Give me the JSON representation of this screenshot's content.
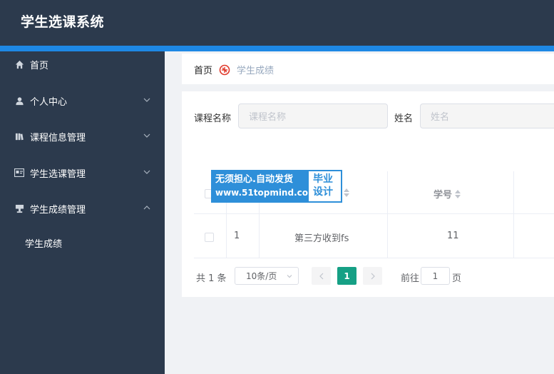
{
  "app": {
    "title": "学生选课系统"
  },
  "sidebar": {
    "items": [
      {
        "label": "首页",
        "icon": "home-icon"
      },
      {
        "label": "个人中心",
        "icon": "user-icon"
      },
      {
        "label": "课程信息管理",
        "icon": "book-icon"
      },
      {
        "label": "学生选课管理",
        "icon": "id-card-icon"
      },
      {
        "label": "学生成绩管理",
        "icon": "trophy-icon"
      }
    ],
    "sub_items": [
      {
        "label": "学生成绩"
      }
    ]
  },
  "breadcrumb": {
    "home": "首页",
    "current": "学生成绩"
  },
  "search": {
    "course_label": "课程名称",
    "course_placeholder": "课程名称",
    "name_label": "姓名",
    "name_placeholder": "姓名"
  },
  "table": {
    "headers": [
      "学号"
    ],
    "rows": [
      {
        "index": "1",
        "course": "第三方收到fs",
        "student_no": "11"
      }
    ]
  },
  "pagination": {
    "total": "共 1 条",
    "page_size": "10条/页",
    "current_page": "1",
    "goto_label": "前往",
    "goto_value": "1",
    "page_suffix": "页"
  },
  "watermark": {
    "line1": "无须担心.自动发货",
    "line2": "www.51topmind.com",
    "right1": "毕业",
    "right2": "设计"
  },
  "colors": {
    "topbar": "#2c3a4d",
    "accent": "#1e88e5",
    "active_page": "#16a085"
  }
}
